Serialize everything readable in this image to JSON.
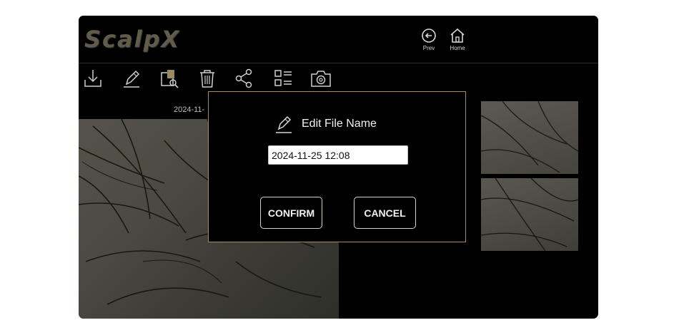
{
  "app": {
    "logo_text": "ScalpX",
    "nav": {
      "prev_label": "Prev",
      "home_label": "Home"
    }
  },
  "toolbar": {
    "icons": [
      "download-icon",
      "edit-icon",
      "analyze-icon",
      "trash-icon",
      "share-icon",
      "list-grid-icon",
      "camera-icon"
    ]
  },
  "gallery": {
    "date_label": "2024-11-"
  },
  "dialog": {
    "title": "Edit File Name",
    "input_value": "2024-11-25 12:08",
    "confirm_label": "CONFIRM",
    "cancel_label": "CANCEL"
  },
  "colors": {
    "background": "#000000",
    "accent_gold": "#a58d5e",
    "logo": "#615b4c",
    "icon_stroke": "#cfcfcf"
  }
}
